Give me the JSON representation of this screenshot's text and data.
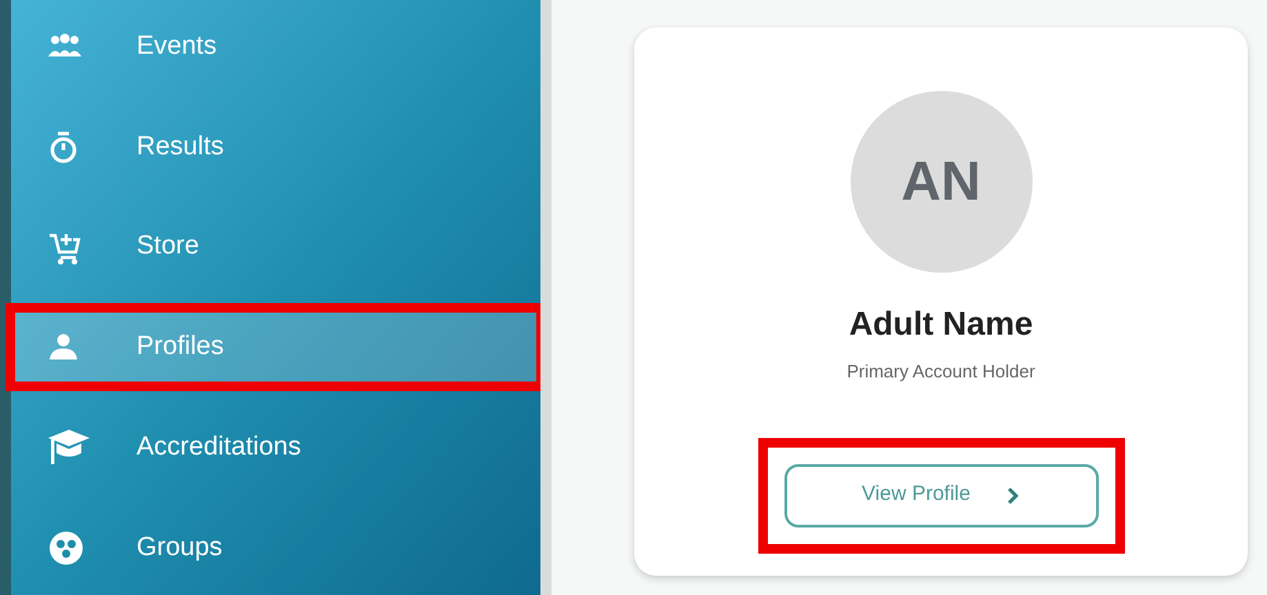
{
  "sidebar": {
    "items": [
      {
        "label": "Events",
        "selected": false,
        "callout": false
      },
      {
        "label": "Results",
        "selected": false,
        "callout": false
      },
      {
        "label": "Store",
        "selected": false,
        "callout": false
      },
      {
        "label": "Profiles",
        "selected": true,
        "callout": true
      },
      {
        "label": "Accreditations",
        "selected": false,
        "callout": false
      },
      {
        "label": "Groups",
        "selected": false,
        "callout": false
      }
    ]
  },
  "profile_card": {
    "initials": "AN",
    "name": "Adult Name",
    "role": "Primary Account Holder",
    "button": {
      "label": "View Profile",
      "callout": true
    }
  }
}
